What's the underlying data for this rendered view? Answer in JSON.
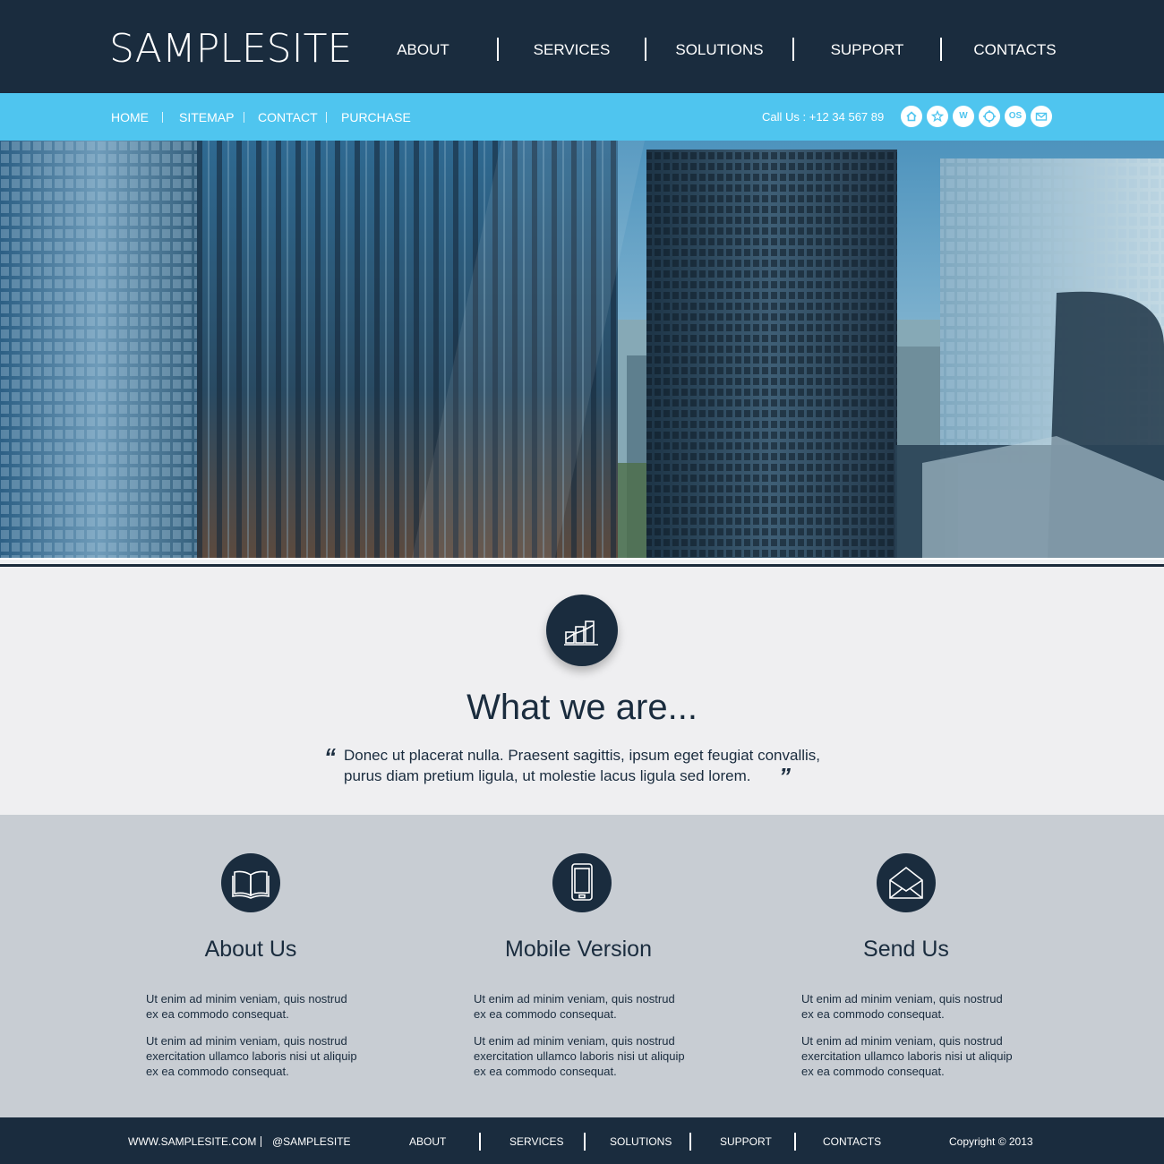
{
  "header": {
    "logo": "SAMPLESITE",
    "nav": [
      "ABOUT",
      "SERVICES",
      "SOLUTIONS",
      "SUPPORT",
      "CONTACTS"
    ]
  },
  "subbar": {
    "links": [
      "HOME",
      "SITEMAP",
      "CONTACT",
      "PURCHASE"
    ],
    "call": "Call Us : +12 34 567 89",
    "socials": [
      "home-icon",
      "star-icon",
      "W",
      "target-icon",
      "OS",
      "mail-icon"
    ]
  },
  "hero": {
    "image": "city-skyscrapers-photo"
  },
  "intro": {
    "icon": "bar-chart-icon",
    "title": "What we are...",
    "quote_line1": "Donec ut placerat nulla. Praesent sagittis, ipsum eget feugiat convallis,",
    "quote_line2": "purus diam pretium ligula, ut molestie lacus ligula sed lorem."
  },
  "features": [
    {
      "icon": "book-icon",
      "title": "About Us",
      "p1a": "Ut enim ad minim veniam, quis nostrud",
      "p1b": "ex ea commodo consequat.",
      "p2a": "Ut enim ad minim veniam, quis nostrud",
      "p2b": "exercitation ullamco laboris nisi ut aliquip",
      "p2c": "ex ea commodo consequat."
    },
    {
      "icon": "mobile-icon",
      "title": "Mobile Version",
      "p1a": "Ut enim ad minim veniam, quis nostrud",
      "p1b": "ex ea commodo consequat.",
      "p2a": "Ut enim ad minim veniam, quis nostrud",
      "p2b": "exercitation ullamco laboris nisi ut aliquip",
      "p2c": "ex ea commodo consequat."
    },
    {
      "icon": "envelope-icon",
      "title": "Send Us",
      "p1a": "Ut enim ad minim veniam, quis nostrud",
      "p1b": "ex ea commodo consequat.",
      "p2a": "Ut enim ad minim veniam, quis nostrud",
      "p2b": "exercitation ullamco laboris nisi ut aliquip",
      "p2c": "ex ea commodo consequat."
    }
  ],
  "footer": {
    "website": "WWW.SAMPLESITE.COM",
    "handle": "@SAMPLESITE",
    "nav": [
      "ABOUT",
      "SERVICES",
      "SOLUTIONS",
      "SUPPORT",
      "CONTACTS"
    ],
    "copyright": "Copyright © 2013"
  },
  "colors": {
    "dark": "#1a2c3e",
    "accent": "#4fc5ef",
    "light_band": "#efeff1",
    "gray_band": "#c8cdd3"
  }
}
